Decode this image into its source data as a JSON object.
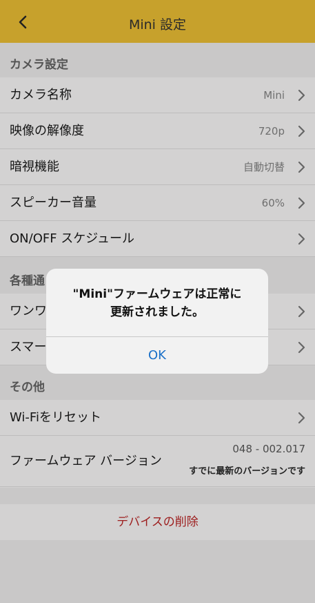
{
  "nav": {
    "title": "Mini 設定"
  },
  "sections": {
    "camera": {
      "header": "カメラ設定",
      "rows": [
        {
          "label": "カメラ名称",
          "value": "Mini"
        },
        {
          "label": "映像の解像度",
          "value": "720p"
        },
        {
          "label": "暗視機能",
          "value": "自動切替"
        },
        {
          "label": "スピーカー音量",
          "value": "60%"
        },
        {
          "label": "ON/OFF スケジュール",
          "value": ""
        }
      ]
    },
    "notify": {
      "header": "各種通",
      "rows": [
        {
          "label": "ワンワ"
        },
        {
          "label": "スマー"
        }
      ]
    },
    "other": {
      "header": "その他",
      "wifi_reset": "Wi-Fiをリセット",
      "firmware": {
        "label": "ファームウェア バージョン",
        "version": "048 - 002.017",
        "status": "すでに最新のバージョンです"
      }
    }
  },
  "delete_label": "デバイスの削除",
  "dialog": {
    "line1": "\"Mini\"ファームウェアは正常に",
    "line2": "更新されました。",
    "ok": "OK"
  },
  "colors": {
    "nav_bg": "#c7a12c",
    "delete_text": "#9c1c1c",
    "ok_text": "#1a70c8"
  }
}
